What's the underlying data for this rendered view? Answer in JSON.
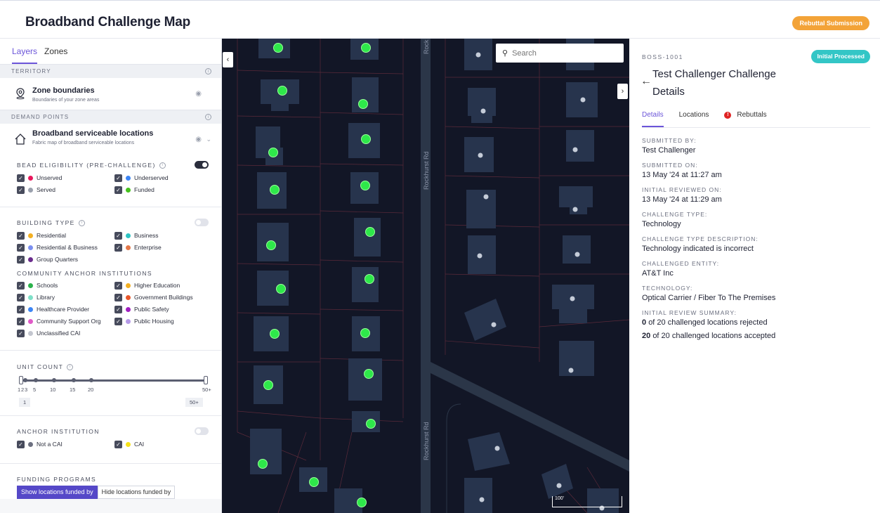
{
  "header": {
    "title": "Broadband Challenge Map",
    "rebuttal_button": "Rebuttal Submission"
  },
  "sidebar": {
    "tabs": [
      "Layers",
      "Zones"
    ],
    "territory_heading": "TERRITORY",
    "zone_layer": {
      "title": "Zone boundaries",
      "subtitle": "Boundaries of your zone areas"
    },
    "demand_heading": "DEMAND POINTS",
    "bsl_layer": {
      "title": "Broadband serviceable locations",
      "subtitle": "Fabric map of broadband serviceable locations"
    },
    "bead": {
      "label": "BEAD ELIGIBILITY (PRE-CHALLENGE)",
      "toggle_on": true,
      "items": [
        {
          "label": "Unserved",
          "color": "#e8185c"
        },
        {
          "label": "Underserved",
          "color": "#3d86f5"
        },
        {
          "label": "Served",
          "color": "#9aa0ad"
        },
        {
          "label": "Funded",
          "color": "#46c21e"
        }
      ]
    },
    "building": {
      "label": "BUILDING TYPE",
      "toggle_on": false,
      "items": [
        {
          "label": "Residential",
          "color": "#f3b023"
        },
        {
          "label": "Business",
          "color": "#2ec4c4"
        },
        {
          "label": "Residential & Business",
          "color": "#7b8ff0"
        },
        {
          "label": "Enterprise",
          "color": "#e4784a"
        },
        {
          "label": "Group Quarters",
          "color": "#6a2c8c"
        }
      ]
    },
    "cai": {
      "label": "COMMUNITY ANCHOR INSTITUTIONS",
      "items": [
        {
          "label": "Schools",
          "color": "#2bb24c"
        },
        {
          "label": "Higher Education",
          "color": "#f3b023"
        },
        {
          "label": "Library",
          "color": "#7fe0c8"
        },
        {
          "label": "Government Buildings",
          "color": "#e9572b"
        },
        {
          "label": "Healthcare Provider",
          "color": "#3d86f5"
        },
        {
          "label": "Public Safety",
          "color": "#a020c0"
        },
        {
          "label": "Community Support Org",
          "color": "#e05ac8"
        },
        {
          "label": "Public Housing",
          "color": "#b59ae8"
        },
        {
          "label": "Unclassified CAI",
          "color": "#c3c6cf"
        }
      ]
    },
    "unit_count": {
      "label": "UNIT COUNT",
      "ticks": [
        "1",
        "2",
        "3",
        "5",
        "10",
        "15",
        "20",
        "50+"
      ],
      "min_value": "1",
      "max_value": "50+"
    },
    "anchor": {
      "label": "ANCHOR INSTITUTION",
      "toggle_on": false,
      "items": [
        {
          "label": "Not a CAI",
          "color": "#6c7080"
        },
        {
          "label": "CAI",
          "color": "#f7e21a"
        }
      ]
    },
    "funding": {
      "label": "FUNDING PROGRAMS",
      "show_btn": "Show locations funded by",
      "hide_btn": "Hide locations funded by"
    }
  },
  "map": {
    "search_placeholder": "Search",
    "road_name": "Rockhurst Rd",
    "road_label_top": "Rock",
    "scale_label": "100'",
    "colors": {
      "background": "#121626",
      "road": "#2b3648",
      "building": "#27344d",
      "funded": "#2ee84a",
      "served": "#c5ccd8"
    }
  },
  "details": {
    "id": "BOSS-1001",
    "status": "Initial Processed",
    "title": "Test Challenger Challenge Details",
    "tabs": [
      "Details",
      "Locations",
      "Rebuttals"
    ],
    "fields": [
      {
        "label": "SUBMITTED BY:",
        "value": "Test Challenger"
      },
      {
        "label": "SUBMITTED ON:",
        "value": "13 May '24 at 11:27 am"
      },
      {
        "label": "INITIAL REVIEWED ON:",
        "value": "13 May '24 at 11:29 am"
      },
      {
        "label": "CHALLENGE TYPE:",
        "value": "Technology"
      },
      {
        "label": "CHALLENGE TYPE DESCRIPTION:",
        "value": "Technology indicated is incorrect"
      },
      {
        "label": "CHALLENGED ENTITY:",
        "value": "AT&T Inc"
      },
      {
        "label": "TECHNOLOGY:",
        "value": "Optical Carrier / Fiber To The Premises"
      }
    ],
    "summary": {
      "label": "INITIAL REVIEW SUMMARY:",
      "rejected_count": "0",
      "rejected_text": "of 20 challenged locations rejected",
      "accepted_count": "20",
      "accepted_text": "of 20 challenged locations accepted"
    }
  }
}
